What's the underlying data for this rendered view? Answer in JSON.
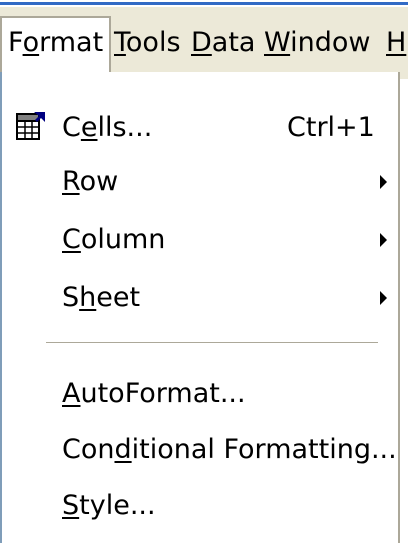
{
  "menubar": {
    "items": [
      {
        "before": "F",
        "ul": "o",
        "after": "rmat",
        "active": true
      },
      {
        "before": "",
        "ul": "T",
        "after": "ools",
        "active": false
      },
      {
        "before": "",
        "ul": "D",
        "after": "ata",
        "active": false
      },
      {
        "before": "",
        "ul": "W",
        "after": "indow",
        "active": false
      },
      {
        "before": "",
        "ul": "H",
        "after": "",
        "active": false
      }
    ]
  },
  "format_menu": {
    "items": [
      {
        "before": "C",
        "ul": "e",
        "after": "lls...",
        "shortcut": "Ctrl+1",
        "icon": "format-cells-icon"
      },
      {
        "before": "",
        "ul": "R",
        "after": "ow",
        "submenu": true
      },
      {
        "before": "",
        "ul": "C",
        "after": "olumn",
        "submenu": true
      },
      {
        "before": "S",
        "ul": "h",
        "after": "eet",
        "submenu": true
      },
      {
        "before": "",
        "ul": "A",
        "after": "utoFormat..."
      },
      {
        "before": "Con",
        "ul": "d",
        "after": "itional Formatting..."
      },
      {
        "before": "",
        "ul": "S",
        "after": "tyle..."
      }
    ]
  },
  "colors": {
    "menubar_bg": "#ece9d8",
    "menu_bg": "#ffffff",
    "title_accent": "#316ac5"
  }
}
